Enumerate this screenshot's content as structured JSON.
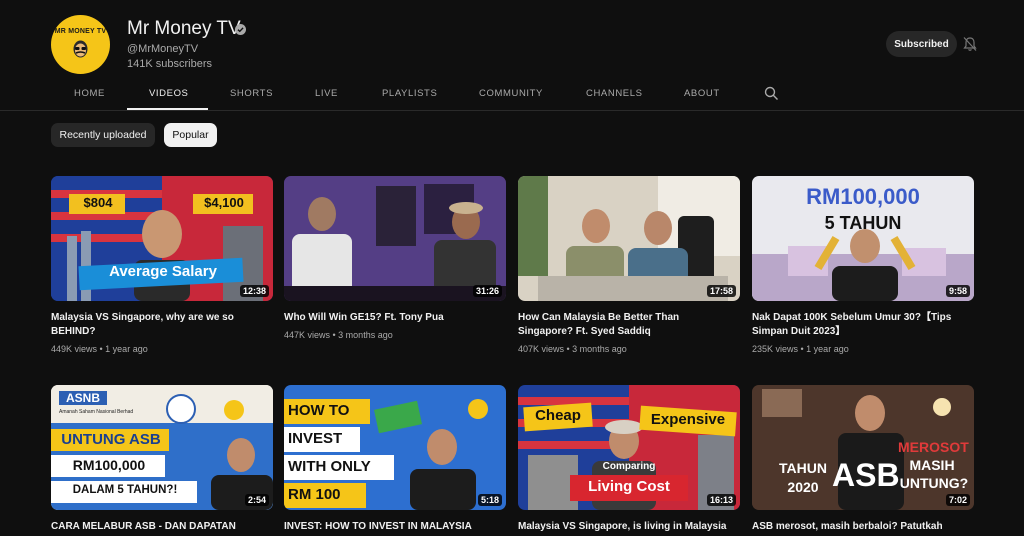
{
  "channel": {
    "avatar_text": "MR MONEY TV",
    "name": "Mr Money TV",
    "handle": "@MrMoneyTV",
    "subscribers": "141K subscribers",
    "subscribe_label": "Subscribed"
  },
  "tabs": [
    {
      "label": "HOME"
    },
    {
      "label": "VIDEOS"
    },
    {
      "label": "SHORTS"
    },
    {
      "label": "LIVE"
    },
    {
      "label": "PLAYLISTS"
    },
    {
      "label": "COMMUNITY"
    },
    {
      "label": "CHANNELS"
    },
    {
      "label": "ABOUT"
    }
  ],
  "active_tab": "VIDEOS",
  "chips": [
    {
      "label": "Recently uploaded",
      "selected": false
    },
    {
      "label": "Popular",
      "selected": true
    }
  ],
  "videos": [
    {
      "title": "Malaysia VS Singapore, why are we so BEHIND?",
      "meta": "449K views • 1 year ago",
      "duration": "12:38",
      "thumb_text": [
        "$804",
        "$4,100",
        "Average Salary"
      ]
    },
    {
      "title": "Who Will Win GE15? Ft. Tony Pua",
      "meta": "447K views • 3 months ago",
      "duration": "31:26",
      "thumb_text": []
    },
    {
      "title": "How Can Malaysia Be Better Than Singapore? Ft. Syed Saddiq",
      "meta": "407K views • 3 months ago",
      "duration": "17:58",
      "thumb_text": []
    },
    {
      "title": "Nak Dapat 100K Sebelum Umur 30?【Tips Simpan Duit 2023】",
      "meta": "235K views • 1 year ago",
      "duration": "9:58",
      "thumb_text": [
        "RM100,000",
        "5 TAHUN"
      ]
    },
    {
      "title": "CARA MELABUR ASB - DAN DAPATAN",
      "meta": "",
      "duration": "2:54",
      "thumb_text": [
        "ASNB",
        "Amanah Saham Nasional Berhad",
        "UNTUNG ASB",
        "RM100,000",
        "DALAM 5 TAHUN?!"
      ]
    },
    {
      "title": "INVEST: HOW TO INVEST IN MALAYSIA",
      "meta": "",
      "duration": "5:18",
      "thumb_text": [
        "HOW TO",
        "INVEST",
        "WITH ONLY",
        "RM 100"
      ]
    },
    {
      "title": "Malaysia VS Singapore, is living in Malaysia",
      "meta": "",
      "duration": "16:13",
      "thumb_text": [
        "Cheap",
        "Expensive",
        "Comparing",
        "Living Cost"
      ]
    },
    {
      "title": "ASB merosot, masih berbaloi? Patutkah",
      "meta": "",
      "duration": "7:02",
      "thumb_text": [
        "TAHUN",
        "2020",
        "ASB",
        "MEROSOT",
        "MASIH",
        "UNTUNG?"
      ]
    }
  ],
  "icons": {
    "verified": "verified-check-icon",
    "bell": "notifications-off-icon",
    "search": "search-icon"
  },
  "colors": {
    "background": "#0f0f0f",
    "text_primary": "#f1f1f1",
    "text_secondary": "#aaaaaa",
    "avatar_yellow": "#f5c518"
  }
}
